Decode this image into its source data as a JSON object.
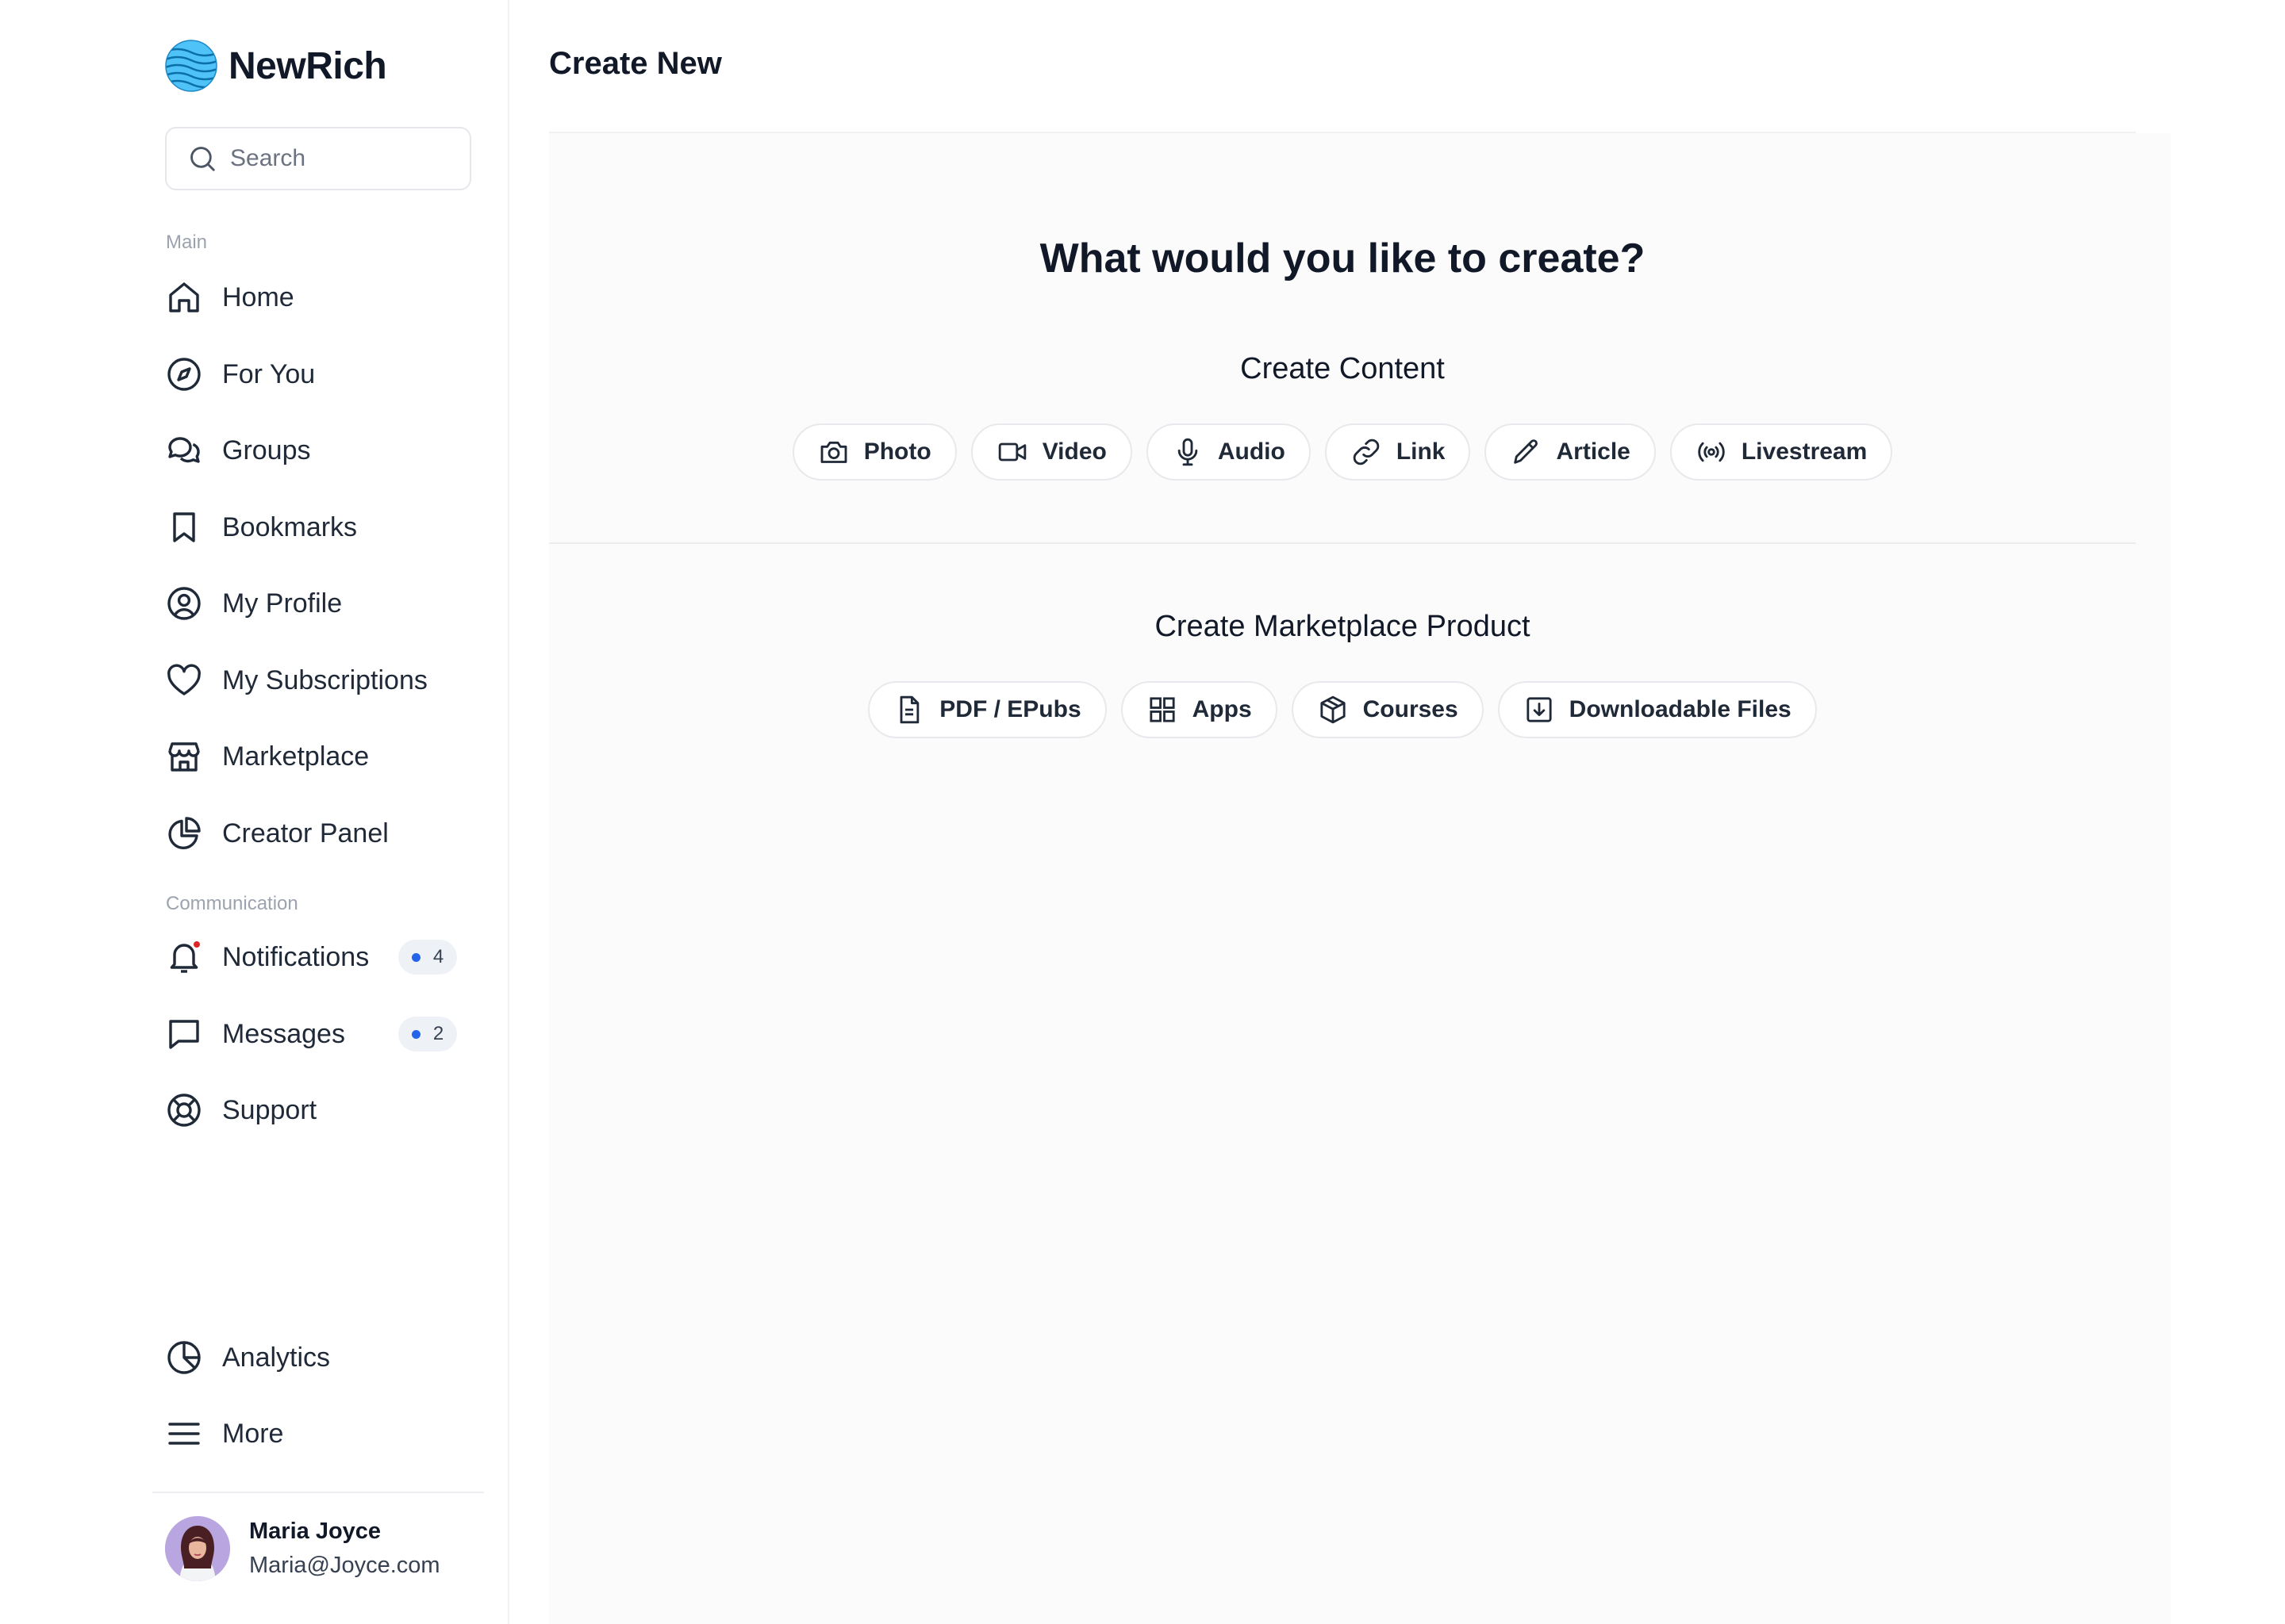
{
  "brand": {
    "name": "NewRich"
  },
  "search": {
    "placeholder": "Search"
  },
  "sidebar": {
    "main_label": "Main",
    "main_items": [
      {
        "label": "Home",
        "icon": "home-icon"
      },
      {
        "label": "For You",
        "icon": "compass-icon"
      },
      {
        "label": "Groups",
        "icon": "chat-bubbles-icon"
      },
      {
        "label": "Bookmarks",
        "icon": "bookmark-icon"
      },
      {
        "label": "My Profile",
        "icon": "user-circle-icon"
      },
      {
        "label": "My Subscriptions",
        "icon": "heart-icon"
      },
      {
        "label": "Marketplace",
        "icon": "store-icon"
      },
      {
        "label": "Creator Panel",
        "icon": "pie-chart-icon"
      }
    ],
    "communication_label": "Communication",
    "communication_items": [
      {
        "label": "Notifications",
        "icon": "bell-icon",
        "badge": "4"
      },
      {
        "label": "Messages",
        "icon": "message-icon",
        "badge": "2"
      },
      {
        "label": "Support",
        "icon": "lifebuoy-icon"
      }
    ],
    "bottom_items": [
      {
        "label": "Analytics",
        "icon": "chart-pie-icon"
      },
      {
        "label": "More",
        "icon": "menu-icon"
      }
    ]
  },
  "user": {
    "name": "Maria Joyce",
    "email": "Maria@Joyce.com"
  },
  "main": {
    "title": "Create New",
    "question": "What would you like to create?",
    "content_section": {
      "title": "Create Content",
      "options": [
        {
          "label": "Photo",
          "icon": "camera-icon"
        },
        {
          "label": "Video",
          "icon": "video-icon"
        },
        {
          "label": "Audio",
          "icon": "microphone-icon"
        },
        {
          "label": "Link",
          "icon": "link-icon"
        },
        {
          "label": "Article",
          "icon": "pencil-icon"
        },
        {
          "label": "Livestream",
          "icon": "broadcast-icon"
        }
      ]
    },
    "marketplace_section": {
      "title": "Create Marketplace Product",
      "options": [
        {
          "label": "PDF / EPubs",
          "icon": "document-icon"
        },
        {
          "label": "Apps",
          "icon": "grid-icon"
        },
        {
          "label": "Courses",
          "icon": "cube-icon"
        },
        {
          "label": "Downloadable Files",
          "icon": "download-icon"
        }
      ]
    }
  },
  "colors": {
    "accent": "#2563eb",
    "notification_dot": "#dc2626",
    "logo": "#38bdf8"
  }
}
